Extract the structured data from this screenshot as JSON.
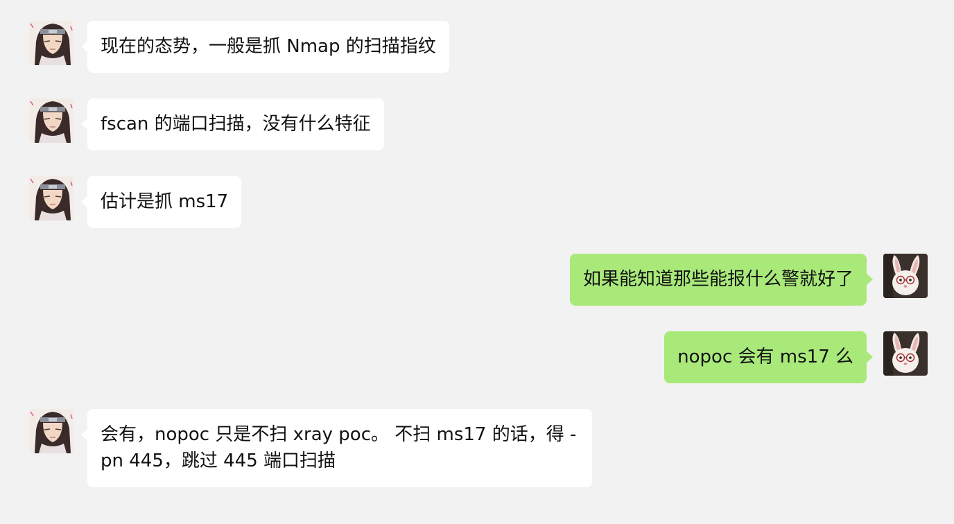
{
  "chat": {
    "messages": [
      {
        "side": "left",
        "sender": "neji",
        "text": "现在的态势，一般是抓 Nmap 的扫描指纹"
      },
      {
        "side": "left",
        "sender": "neji",
        "text": "fscan 的端口扫描，没有什么特征"
      },
      {
        "side": "left",
        "sender": "neji",
        "text": "估计是抓 ms17"
      },
      {
        "side": "right",
        "sender": "rabbit",
        "text": "如果能知道那些能报什么警就好了"
      },
      {
        "side": "right",
        "sender": "rabbit",
        "text": "nopoc 会有 ms17 么"
      },
      {
        "side": "left",
        "sender": "neji",
        "text": "会有，nopoc 只是不扫 xray poc。 不扫 ms17 的话，得 -pn 445，跳过 445 端口扫描"
      }
    ]
  },
  "colors": {
    "background": "#f2f2f2",
    "incoming_bubble": "#ffffff",
    "outgoing_bubble": "#a9e97a",
    "text": "#111111"
  },
  "icons": {
    "incoming_avatar": "anime-character-avatar",
    "outgoing_avatar": "rabbit-with-glasses-avatar"
  }
}
